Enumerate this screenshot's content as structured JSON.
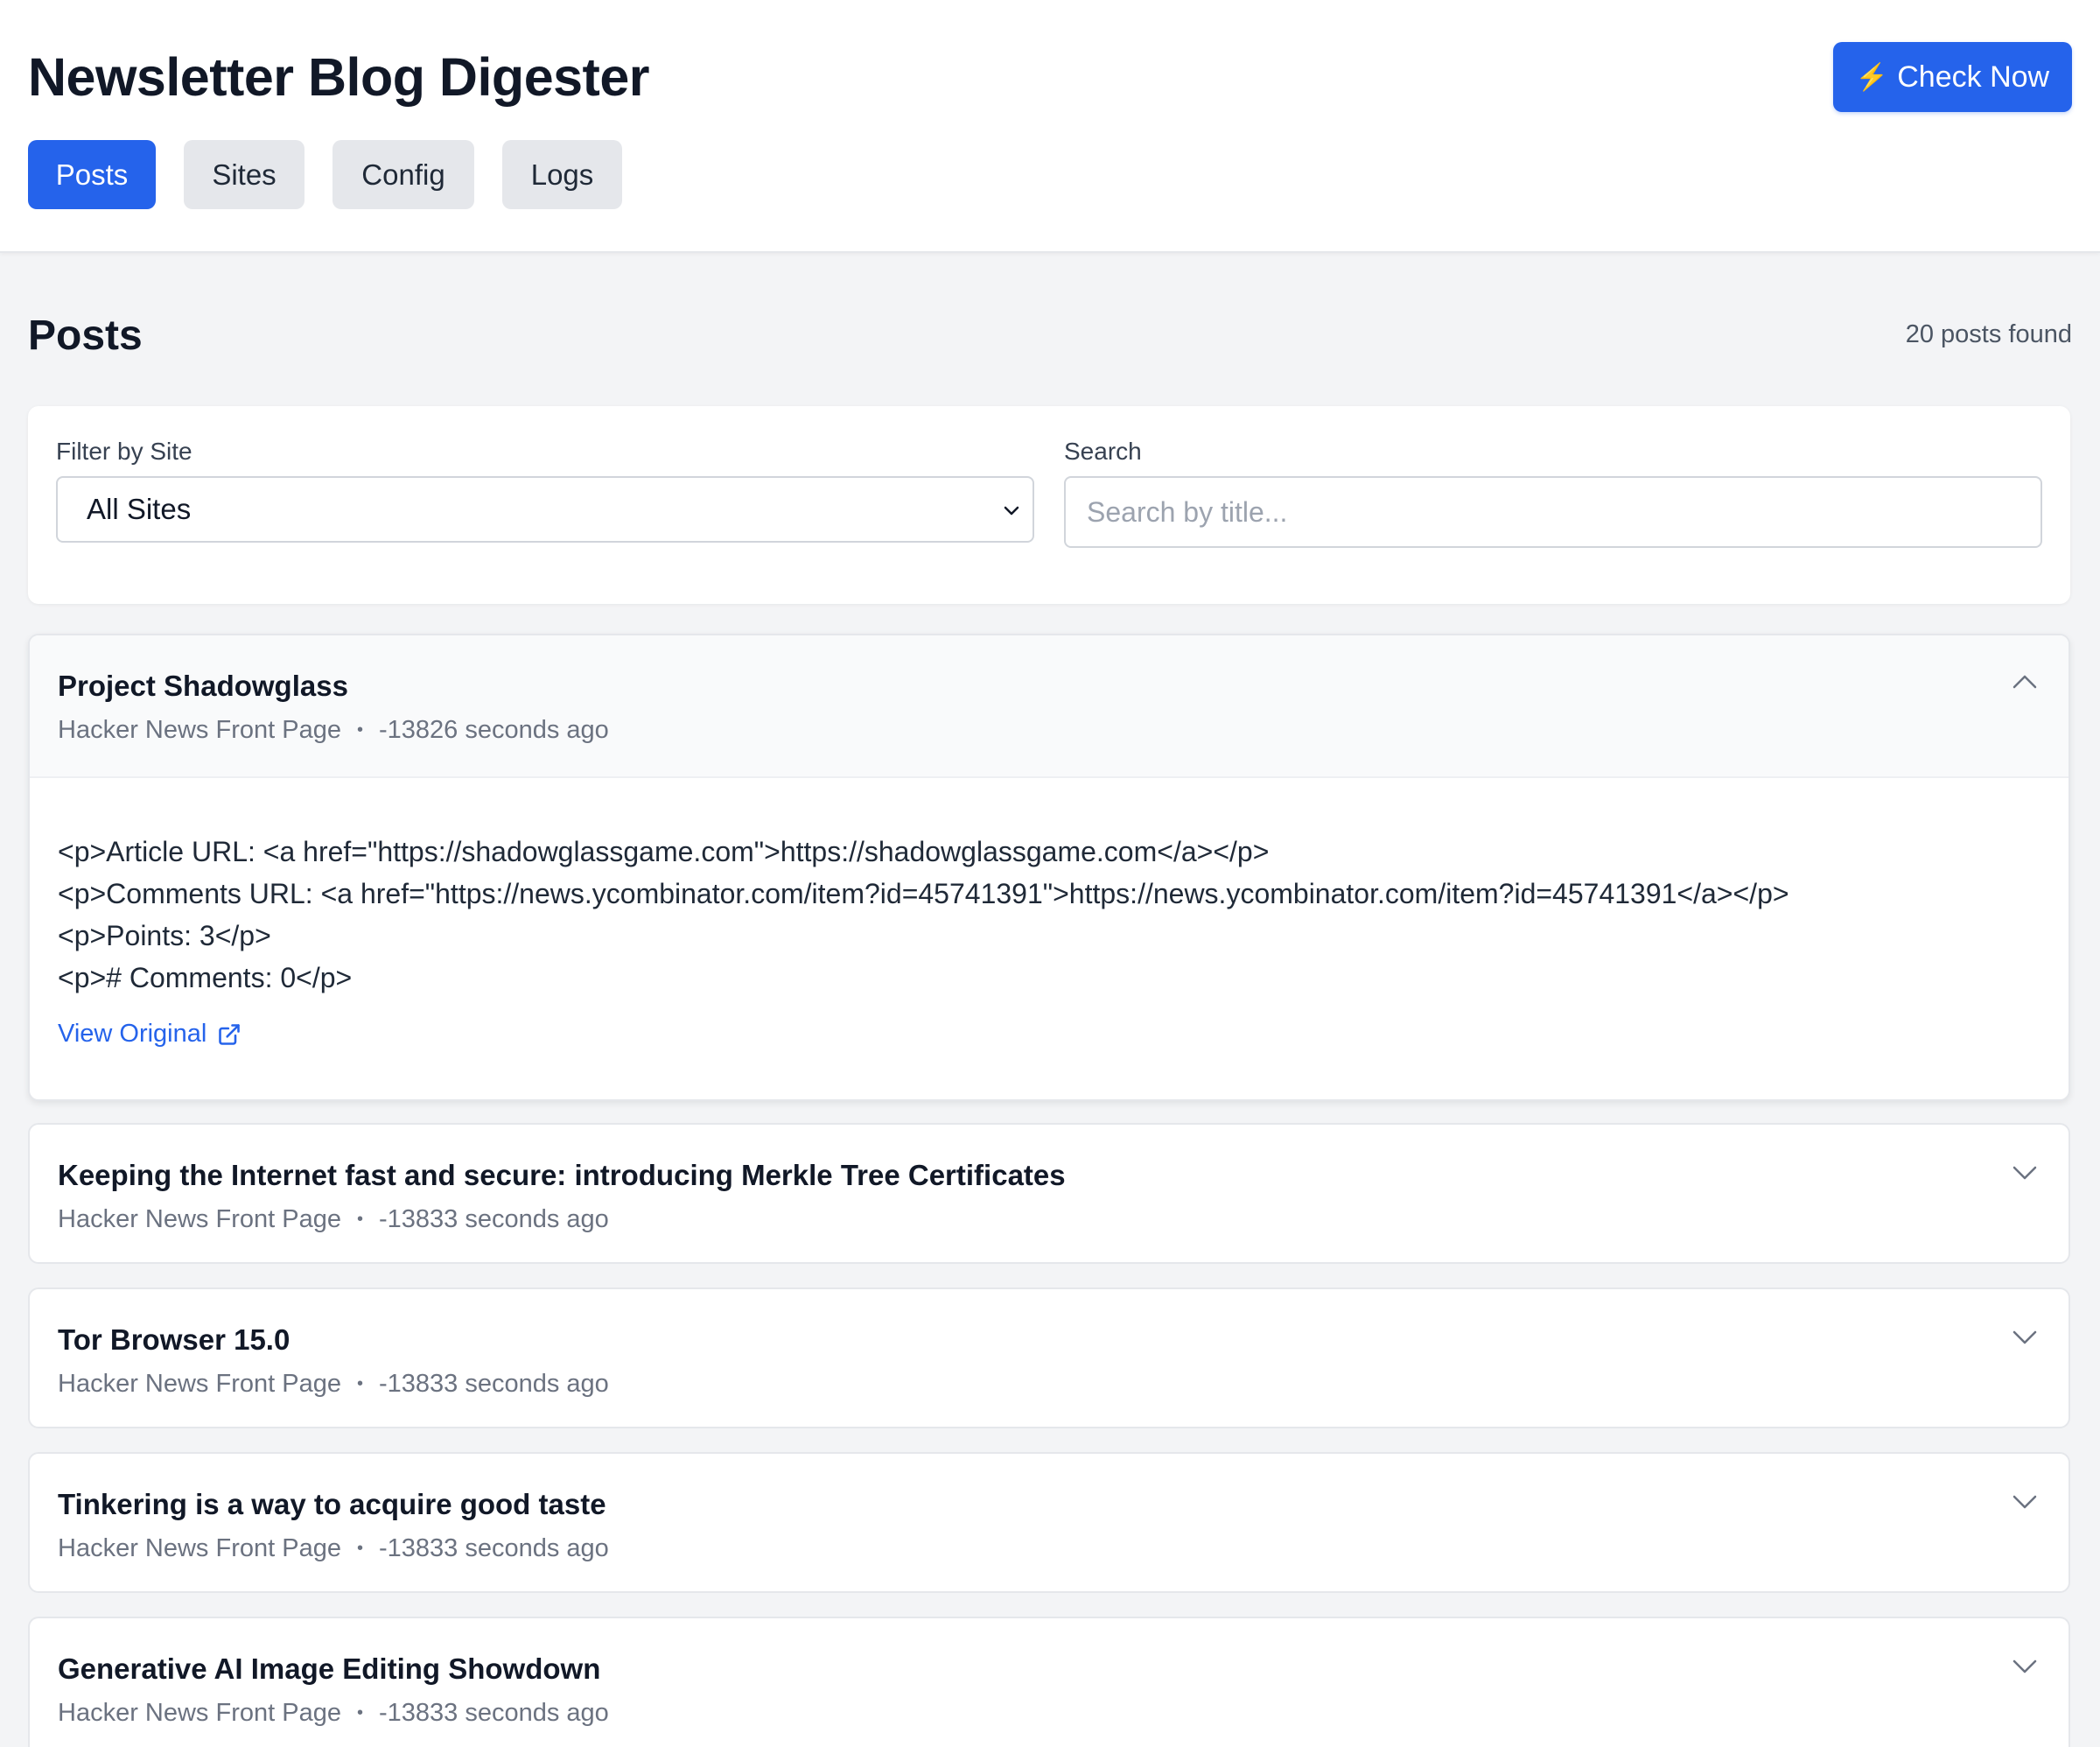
{
  "app": {
    "title": "Newsletter Blog Digester",
    "check_now_icon": "⚡",
    "check_now_label": "Check Now"
  },
  "tabs": [
    {
      "label": "Posts",
      "active": true
    },
    {
      "label": "Sites",
      "active": false
    },
    {
      "label": "Config",
      "active": false
    },
    {
      "label": "Logs",
      "active": false
    }
  ],
  "page": {
    "title": "Posts",
    "count_text": "20 posts found"
  },
  "filters": {
    "site_label": "Filter by Site",
    "site_value": "All Sites",
    "search_label": "Search",
    "search_placeholder": "Search by title...",
    "search_value": ""
  },
  "posts": [
    {
      "title": "Project Shadowglass",
      "site": "Hacker News Front Page",
      "time": "-13826 seconds ago",
      "expanded": true,
      "content": "<p>Article URL: <a href=\"https://shadowglassgame.com\">https://shadowglassgame.com</a></p>\n<p>Comments URL: <a href=\"https://news.ycombinator.com/item?id=45741391\">https://news.ycombinator.com/item?id=45741391</a></p>\n<p>Points: 3</p>\n<p># Comments: 0</p>",
      "link_label": "View Original"
    },
    {
      "title": "Keeping the Internet fast and secure: introducing Merkle Tree Certificates",
      "site": "Hacker News Front Page",
      "time": "-13833 seconds ago",
      "expanded": false
    },
    {
      "title": "Tor Browser 15.0",
      "site": "Hacker News Front Page",
      "time": "-13833 seconds ago",
      "expanded": false
    },
    {
      "title": "Tinkering is a way to acquire good taste",
      "site": "Hacker News Front Page",
      "time": "-13833 seconds ago",
      "expanded": false
    },
    {
      "title": "Generative AI Image Editing Showdown",
      "site": "Hacker News Front Page",
      "time": "-13833 seconds ago",
      "expanded": false
    }
  ],
  "icons": {
    "collapse": "chevron-up-icon",
    "expand": "chevron-down-icon",
    "external_link": "external-link-icon",
    "select_arrow": "chevron-down-icon",
    "check_now": "lightning-bolt-icon"
  },
  "colors": {
    "accent": "#2563eb",
    "bolt": "#fbbf24",
    "background": "#f3f4f6",
    "card": "#ffffff"
  }
}
